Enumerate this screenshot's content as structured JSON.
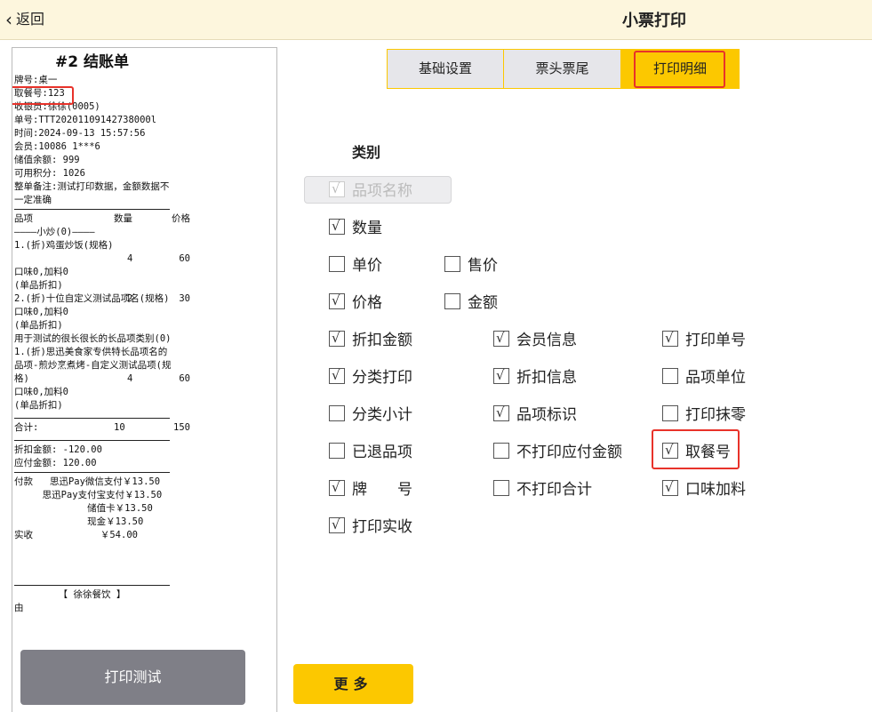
{
  "header": {
    "back_label": "返回",
    "title": "小票打印"
  },
  "receipt": {
    "title": "#2 结账单",
    "lines_top": [
      "牌号:桌一",
      "取餐号:123",
      "收银员:徐徐(0005)",
      "单号:TTT20201109142738000l",
      "时间:2024-09-13 15:57:56",
      "会员:10086  1***6",
      "储值余额: 999",
      "可用积分: 1026"
    ],
    "remark": "整单备注:测试打印数据，金额数据不一定准确",
    "col_headers": [
      "品项",
      "数量",
      "价格"
    ],
    "category_1": "————小炒(0)————",
    "item_1": {
      "name": "1.(折)鸡蛋炒饭(规格)",
      "qty": "4",
      "price": "60",
      "extra": "口味0,加料0",
      "note": "(单品折扣)"
    },
    "item_2": {
      "name": "2.(折)十位自定义测试品项名(规格)",
      "qty": "2",
      "price": "30",
      "extra": "口味0,加料0",
      "note": "(单品折扣)"
    },
    "category_2": "用于测试的很长很长的长品项类别(0)",
    "item_3": {
      "name": "1.(折)思迅美食家专供特长品项名的品项-煎炒烹煮烤-自定义测试品项(规格)",
      "qty": "4",
      "price": "60",
      "extra": "口味0,加料0",
      "note": "(单品折扣)"
    },
    "total": {
      "label": "合计:",
      "qty": "10",
      "amount": "150"
    },
    "discount": "折扣金额:        -120.00",
    "payable": "应付金额:         120.00",
    "pay_lines": [
      "付款   思迅Pay微信支付￥13.50",
      "     思迅Pay支付宝支付￥13.50",
      "             储值卡￥13.50",
      "             现金￥13.50"
    ],
    "actual": "实收            ￥54.00",
    "shop": "【 徐徐餐饮 】",
    "footer_partial": "由"
  },
  "print_test_label": "打印测试",
  "tabs": [
    {
      "label": "基础设置",
      "active": false
    },
    {
      "label": "票头票尾",
      "active": false
    },
    {
      "label": "打印明细",
      "active": true
    }
  ],
  "category_label": "类别",
  "checkboxes": {
    "item_name": {
      "label": "品项名称",
      "checked": true,
      "disabled": true
    },
    "quantity": {
      "label": "数量",
      "checked": true
    },
    "unit_price": {
      "label": "单价",
      "checked": false
    },
    "sale_price": {
      "label": "售价",
      "checked": false
    },
    "price": {
      "label": "价格",
      "checked": true
    },
    "amount": {
      "label": "金额",
      "checked": false
    },
    "discount_amount": {
      "label": "折扣金额",
      "checked": true
    },
    "member_info": {
      "label": "会员信息",
      "checked": true
    },
    "print_order_no": {
      "label": "打印单号",
      "checked": true
    },
    "category_print": {
      "label": "分类打印",
      "checked": true
    },
    "discount_info": {
      "label": "折扣信息",
      "checked": true
    },
    "item_unit": {
      "label": "品项单位",
      "checked": false
    },
    "category_subtotal": {
      "label": "分类小计",
      "checked": false
    },
    "item_mark": {
      "label": "品项标识",
      "checked": true
    },
    "print_rounding": {
      "label": "打印抹零",
      "checked": false
    },
    "returned_items": {
      "label": "已退品项",
      "checked": false
    },
    "no_print_payable": {
      "label": "不打印应付金额",
      "checked": false
    },
    "pickup_no": {
      "label": "取餐号",
      "checked": true
    },
    "table_no": {
      "label": "牌　　号",
      "checked": true
    },
    "no_print_total": {
      "label": "不打印合计",
      "checked": false
    },
    "flavor_addon": {
      "label": "口味加料",
      "checked": true
    },
    "print_actual": {
      "label": "打印实收",
      "checked": true
    }
  },
  "more_label": "更多",
  "colors": {
    "accent": "#fcc800",
    "highlight": "#e8322a",
    "header_bg": "#fdf6dd"
  }
}
